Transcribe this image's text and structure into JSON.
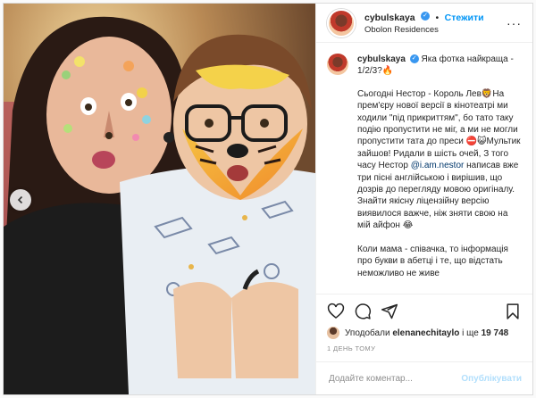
{
  "post": {
    "author": {
      "username": "cybulskaya",
      "verified_icon": "verified-badge-icon",
      "follow_label": "Стежити",
      "separator": "•",
      "location": "Obolon Residences"
    },
    "first_comment": {
      "username": "cybulskaya",
      "text": "Яка фотка найкраща - 1/2/3?🔥"
    },
    "caption": {
      "p1": "Сьогодні Нестор - Король Лев🦁На прем'єру нової версії в кінотеатрі ми ходили \"під прикриттям\", бо тато таку подію пропустити не міг, а ми не могли пропустити тата до преси ⛔😺Мультик зайшов! Ридали в шість очей, З того часу Нестор",
      "mention": "@i.am.nestor",
      "p1_end": " написав вже три пісні англійською і вирішив, що дозрів до перегляду мовою оригіналу. Знайти якісну ліцензійну версію виявилося важче, ніж зняти свою на мій айфон 😂",
      "p2": "Коли мама - співачка, то інформація про букви в абетці і те, що відстать неможливо не живе"
    },
    "likes": {
      "prefix": "Уподобали",
      "user": "elenanechitaylo",
      "middle": "і ще",
      "count": "19 748"
    },
    "timestamp": "1 ДЕНЬ ТОМУ",
    "comment_input": {
      "placeholder": "Додайте коментар..."
    },
    "publish_label": "Опублікувати"
  },
  "icons": [
    "chevron-left-icon",
    "more-icon",
    "heart-icon",
    "comment-icon",
    "share-icon",
    "bookmark-icon",
    "verified-badge-icon"
  ],
  "colors": {
    "accent": "#0095f6",
    "link": "#00376b",
    "muted": "#8e8e8e",
    "publish_disabled": "#b2dffc"
  }
}
